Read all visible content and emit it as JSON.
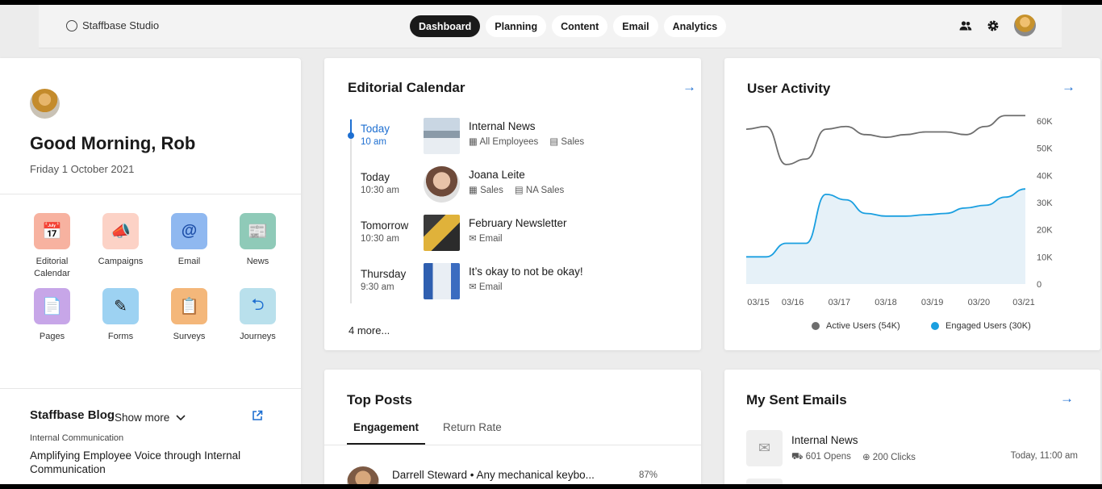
{
  "app": {
    "title": "Staffbase Studio"
  },
  "nav": {
    "items": [
      "Dashboard",
      "Planning",
      "Content",
      "Email",
      "Analytics"
    ],
    "active": "Dashboard"
  },
  "header_icons": [
    "people-icon",
    "gear-icon",
    "user-avatar"
  ],
  "greeting": {
    "title": "Good Morning, Rob",
    "date": "Friday 1 October 2021"
  },
  "apps": [
    {
      "label": "Editorial Calendar",
      "icon": "calendar-clock-icon",
      "color": "#f7b2a0"
    },
    {
      "label": "Campaigns",
      "icon": "megaphone-icon",
      "color": "#fcd2c6"
    },
    {
      "label": "Email",
      "icon": "email-icon",
      "color": "#8fb8f0"
    },
    {
      "label": "News",
      "icon": "news-icon",
      "color": "#8fcab8"
    },
    {
      "label": "Pages",
      "icon": "page-icon",
      "color": "#c7a6e8"
    },
    {
      "label": "Forms",
      "icon": "form-icon",
      "color": "#9dd2f2"
    },
    {
      "label": "Surveys",
      "icon": "survey-icon",
      "color": "#f4b77a"
    },
    {
      "label": "Journeys",
      "icon": "journey-icon",
      "color": "#b9e0ec"
    }
  ],
  "show_more": "Show more",
  "blog": {
    "title": "Staffbase Blog",
    "category": "Internal Communication",
    "headline": "Amplifying Employee Voice through Internal Communication"
  },
  "calendar": {
    "title": "Editorial Calendar",
    "events": [
      {
        "when": "Today",
        "time": "10 am",
        "name": "Internal News",
        "meta": [
          "All Employees",
          "Sales"
        ]
      },
      {
        "when": "Today",
        "time": "10:30 am",
        "name": "Joana Leite",
        "meta": [
          "Sales",
          "NA Sales"
        ]
      },
      {
        "when": "Tomorrow",
        "time": "10:30 am",
        "name": "February Newsletter",
        "meta": [
          "Email"
        ]
      },
      {
        "when": "Thursday",
        "time": "9:30 am",
        "name": "It’s okay to not be okay!",
        "meta": [
          "Email"
        ]
      }
    ],
    "more": "4 more..."
  },
  "user_activity": {
    "title": "User Activity"
  },
  "chart_data": {
    "type": "line",
    "title": "User Activity",
    "x": [
      "03/15",
      "03/16",
      "03/17",
      "03/18",
      "03/19",
      "03/20",
      "03/21"
    ],
    "series": [
      {
        "name": "Active Users (54K)",
        "color": "#6e6e6e",
        "values": [
          57000,
          58000,
          44000,
          46000,
          57000,
          58000,
          55000,
          54000,
          55000,
          56000,
          56000,
          55000,
          58000,
          62000,
          62000
        ]
      },
      {
        "name": "Engaged Users (30K)",
        "color": "#1a9fe0",
        "values": [
          10000,
          10000,
          15000,
          15000,
          33000,
          31000,
          26000,
          25000,
          25000,
          25500,
          26000,
          28000,
          29000,
          32000,
          35000
        ]
      }
    ],
    "ylim": [
      0,
      60000
    ],
    "yticks": [
      "0",
      "10K",
      "20K",
      "30K",
      "40K",
      "50K",
      "60K"
    ],
    "grid": false,
    "legend": "bottom"
  },
  "top_posts": {
    "title": "Top Posts",
    "tabs": [
      "Engagement",
      "Return Rate"
    ],
    "active_tab": "Engagement",
    "rows": [
      {
        "text": "Darrell Steward • Any mechanical keybo...",
        "pct": "87%"
      }
    ]
  },
  "sent_emails": {
    "title": "My Sent Emails",
    "rows": [
      {
        "name": "Internal News",
        "opens": "601 Opens",
        "clicks": "200 Clicks",
        "time": "Today, 11:00 am"
      }
    ]
  }
}
